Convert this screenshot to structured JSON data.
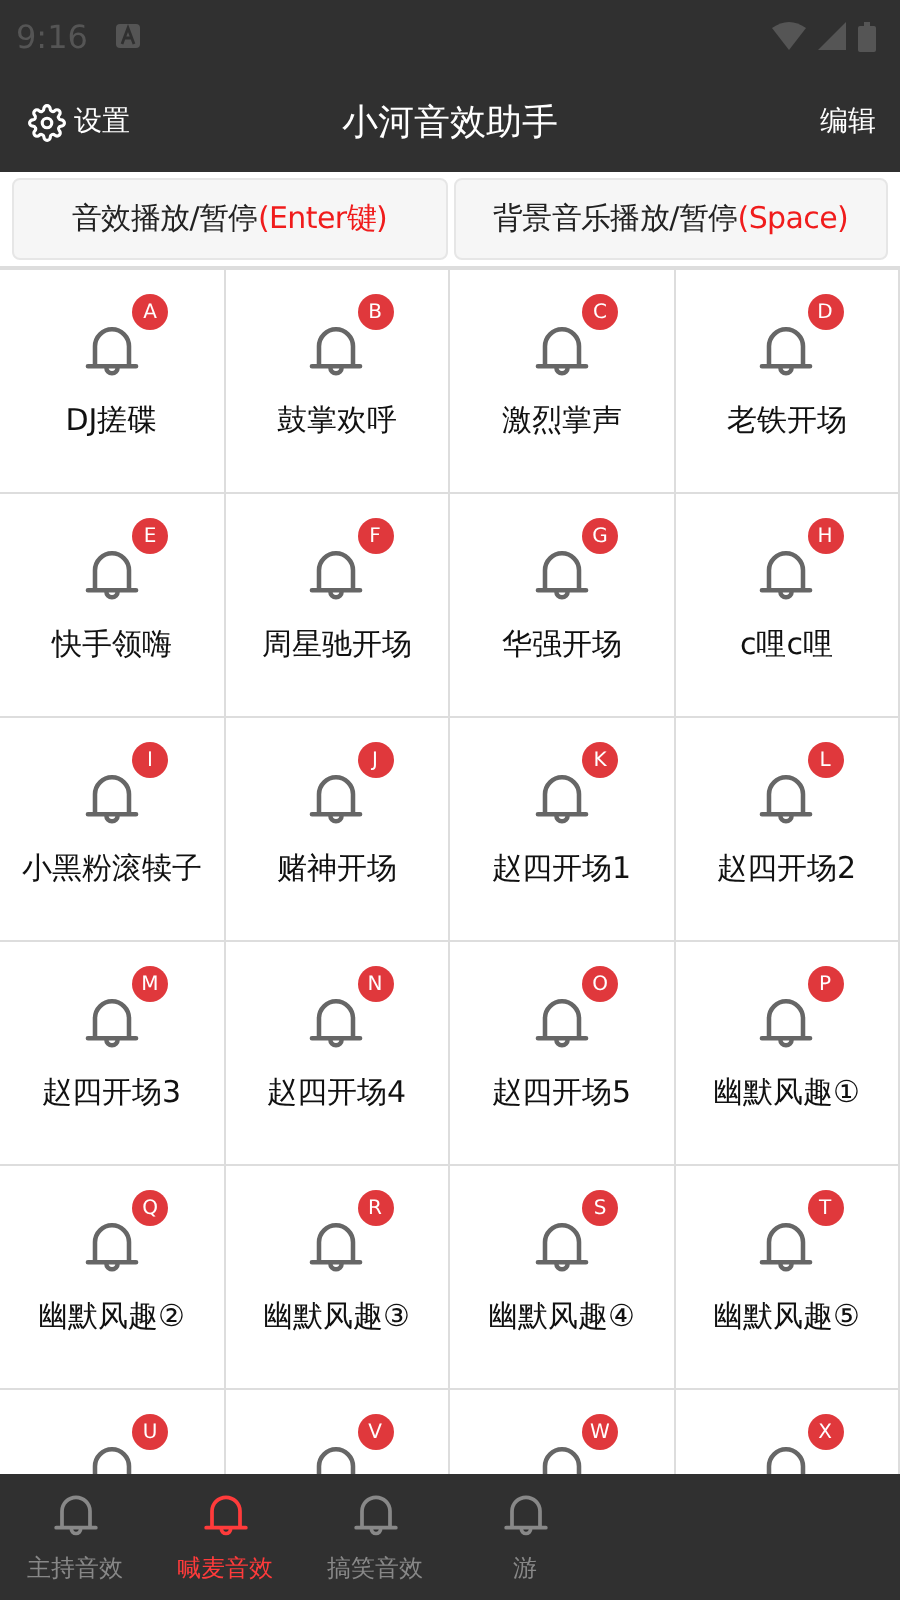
{
  "status_bar": {
    "time": "9:16"
  },
  "header": {
    "settings": "设置",
    "title": "小河音效助手",
    "edit": "编辑"
  },
  "controls": [
    {
      "text": "音效播放/暂停**(Enter键)**"
    },
    {
      "text": "背景音乐播放/暂停**(Space)**"
    }
  ],
  "sounds": [
    {
      "badge": "A",
      "label": "DJ搓碟"
    },
    {
      "badge": "B",
      "label": "鼓掌欢呼"
    },
    {
      "badge": "C",
      "label": "激烈掌声"
    },
    {
      "badge": "D",
      "label": "老铁开场"
    },
    {
      "badge": "E",
      "label": "快手领嗨"
    },
    {
      "badge": "F",
      "label": "周星驰开场"
    },
    {
      "badge": "G",
      "label": "华强开场"
    },
    {
      "badge": "H",
      "label": "c哩c哩"
    },
    {
      "badge": "I",
      "label": "小黑粉滚犊子"
    },
    {
      "badge": "J",
      "label": "赌神开场"
    },
    {
      "badge": "K",
      "label": "赵四开场1"
    },
    {
      "badge": "L",
      "label": "赵四开场2"
    },
    {
      "badge": "M",
      "label": "赵四开场3"
    },
    {
      "badge": "N",
      "label": "赵四开场4"
    },
    {
      "badge": "O",
      "label": "赵四开场5"
    },
    {
      "badge": "P",
      "label": "幽默风趣①"
    },
    {
      "badge": "Q",
      "label": "幽默风趣②"
    },
    {
      "badge": "R",
      "label": "幽默风趣③"
    },
    {
      "badge": "S",
      "label": "幽默风趣④"
    },
    {
      "badge": "T",
      "label": "幽默风趣⑤"
    },
    {
      "badge": "U"
    },
    {
      "badge": "V"
    },
    {
      "badge": "W"
    },
    {
      "badge": "X"
    }
  ],
  "tabs": [
    {
      "label": "主持音效",
      "selected": false
    },
    {
      "label": "喊麦音效",
      "selected": true
    },
    {
      "label": "搞笑音效",
      "selected": false
    },
    {
      "label": "游",
      "selected": false
    }
  ]
}
